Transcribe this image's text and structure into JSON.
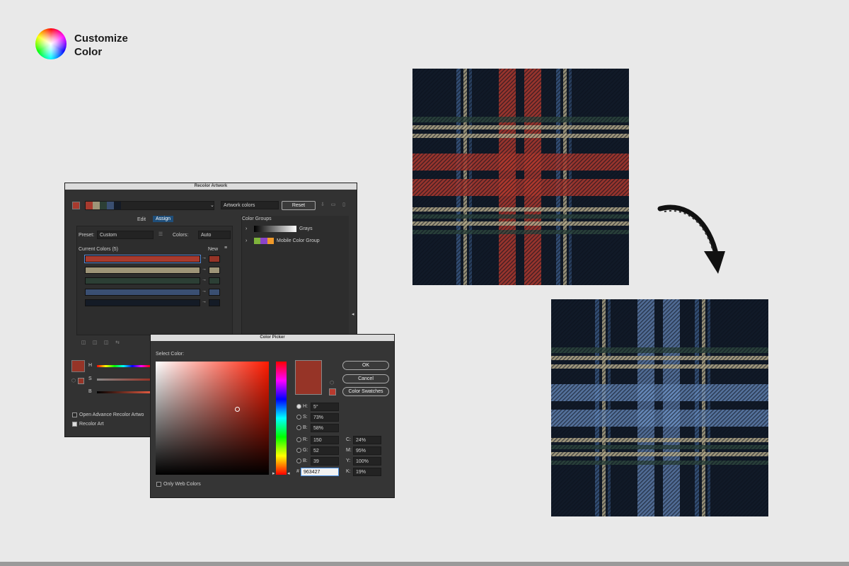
{
  "header": {
    "title_line1": "Customize",
    "title_line2": "Color"
  },
  "colors": {
    "navy": "#111a28",
    "red": "#b03a2e",
    "tan": "#b8ae8c",
    "green": "#2f4a3f",
    "blue": "#3b5a86",
    "bluelight": "#6b8fc2",
    "picked": "#963427",
    "background": "#e9e9e9"
  },
  "recolor": {
    "title": "Recolor Artwork",
    "artwork_colors": "Artwork colors",
    "reset_label": "Reset",
    "tabs": [
      "Edit",
      "Assign"
    ],
    "preset_label": "Preset:",
    "preset_value": "Custom",
    "colors_label": "Colors:",
    "colors_value": "Auto",
    "current_colors_label": "Current Colors (5)",
    "new_label": "New",
    "color_groups_label": "Color Groups",
    "groups": [
      "Grays",
      "Mobile Color Group"
    ],
    "rows": [
      {
        "current": "#a83a2e",
        "new": "#963427"
      },
      {
        "current": "#9e9578",
        "new": "#9e9578"
      },
      {
        "current": "#2c3f35",
        "new": "#2c3f35"
      },
      {
        "current": "#3a4f72",
        "new": "#3a4f72"
      },
      {
        "current": "#141b26",
        "new": "#141b26"
      }
    ],
    "slider_labels": [
      "H",
      "S",
      "B"
    ],
    "open_advance": "Open Advance Recolor Artwo",
    "recolor_art": "Recolor Art"
  },
  "picker": {
    "title": "Color Picker",
    "select_color": "Select Color:",
    "ok": "OK",
    "cancel": "Cancel",
    "swatches": "Color Swatches",
    "only_web": "Only Web Colors",
    "H": "5°",
    "S": "73%",
    "B": "58%",
    "R": "150",
    "G": "52",
    "Bl": "39",
    "C": "24%",
    "M": "95%",
    "Y": "100%",
    "K": "19%",
    "hex": "963427"
  }
}
